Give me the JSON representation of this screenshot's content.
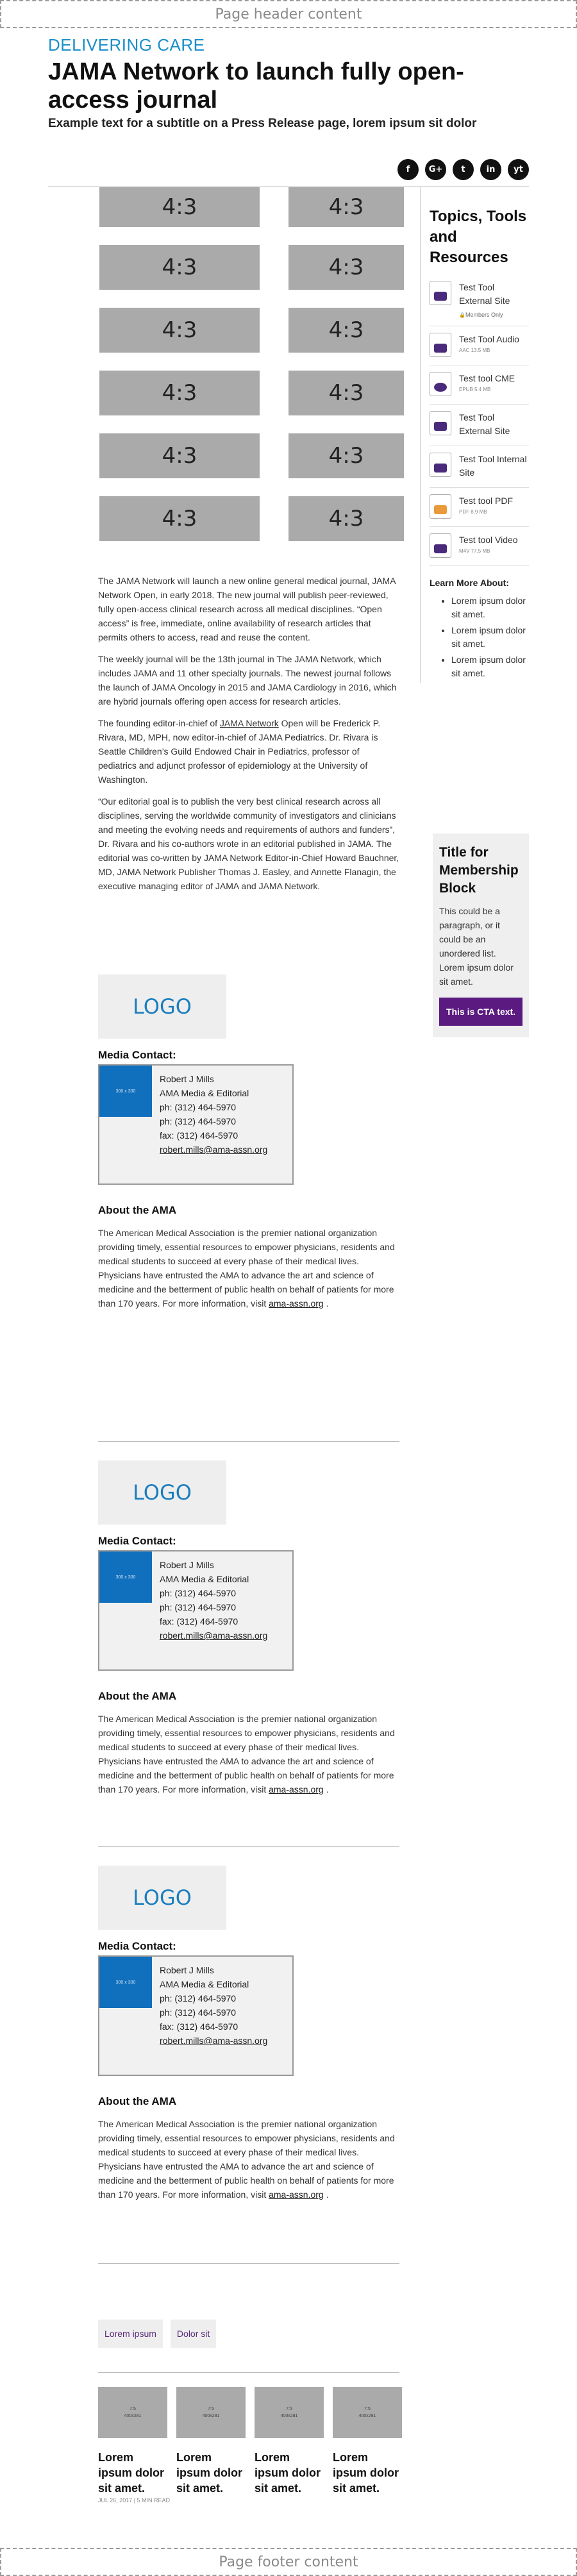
{
  "page_header": "Page header content",
  "page_footer": "Page footer content",
  "kicker": "DELIVERING CARE",
  "title": "JAMA Network to launch fully open-access journal",
  "subtitle": "Example text for a subtitle on a Press Release page, lorem ipsum sit dolor",
  "social": [
    "f",
    "G+",
    "t",
    "in",
    "yt"
  ],
  "ratio_label": "4:3",
  "body": {
    "p1": "The JAMA Network will launch a new online general medical journal, JAMA Network Open, in early 2018. The new journal will publish peer-reviewed, fully open-access clinical research across all medical disciplines. “Open access” is free, immediate, online availability of research articles that permits others to access, read and reuse the content.",
    "p2": "The weekly journal will be the 13th journal in The JAMA Network, which includes JAMA and 11 other specialty journals. The newest journal follows the launch of JAMA Oncology in 2015 and JAMA Cardiology in 2016, which are hybrid journals offering open access for research articles.",
    "p3a": "The founding editor-in-chief of ",
    "p3link": "JAMA Network",
    "p3b": " Open will be Frederick P. Rivara, MD, MPH, now editor-in-chief of JAMA Pediatrics. Dr. Rivara is Seattle Children’s Guild Endowed Chair in Pediatrics, professor of pediatrics and adjunct professor of epidemiology at the University of Washington.",
    "p4": "“Our editorial goal is to publish the very best clinical research across all disciplines, serving the worldwide community of investigators and clinicians and meeting the evolving needs and requirements of authors and funders”, Dr. Rivara and his co-authors wrote in an editorial published in JAMA. The editorial was co-written by JAMA Network Editor-in-Chief Howard Bauchner, MD, JAMA Network Publisher Thomas J. Easley, and Annette Flanagin, the executive managing editor of JAMA and JAMA Network."
  },
  "sidebar": {
    "heading": "Topics, Tools and Resources",
    "tools": [
      {
        "name": "Test Tool External Site",
        "meta": "",
        "badge": "Members Only",
        "icon": "external-site-icon"
      },
      {
        "name": "Test Tool Audio",
        "meta": "AAC        13.5 MB",
        "badge": "",
        "icon": "audio-icon"
      },
      {
        "name": "Test tool CME",
        "meta": "EPUB        5.4 MB",
        "badge": "",
        "icon": "cme-icon"
      },
      {
        "name": "Test Tool External Site",
        "meta": "",
        "badge": "",
        "icon": "external-site-icon"
      },
      {
        "name": "Test Tool Internal Site",
        "meta": "",
        "badge": "",
        "icon": "internal-site-icon"
      },
      {
        "name": "Test tool PDF",
        "meta": "PDF        8.9 MB",
        "badge": "",
        "icon": "pdf-icon"
      },
      {
        "name": "Test tool Video",
        "meta": "M4V        77.5 MB",
        "badge": "",
        "icon": "video-icon"
      }
    ],
    "learn_more": "Learn More About:",
    "learn_items": [
      "Lorem ipsum dolor sit amet.",
      "Lorem ipsum dolor sit amet.",
      "Lorem ipsum dolor sit amet."
    ]
  },
  "membership": {
    "title": "Title for Membership Block",
    "text": "This could be a paragraph, or it could be an unordered list. Lorem ipsum dolor sit amet.",
    "cta": "This is CTA text."
  },
  "contact": {
    "logo": "LOGO",
    "label": "Media Contact:",
    "photo": "300 x 300",
    "name": "Robert J Mills",
    "org": "AMA Media & Editorial",
    "ph1": "ph: (312) 464-5970",
    "ph2": "ph: (312) 464-5970",
    "fax": "fax: (312) 464-5970",
    "email": "robert.mills@ama-assn.org"
  },
  "about": {
    "title": "About the AMA",
    "text": "The American Medical Association is the premier national organization providing timely, essential resources to empower physicians, residents and medical students to succeed at every phase of their medical lives. Physicians have entrusted the AMA to advance the art and science of medicine and the betterment of public health on behalf of patients for more than 170 years. For more information, visit ",
    "link": "ama-assn.org",
    "end": " ."
  },
  "tags": [
    "Lorem ipsum",
    "Dolor sit"
  ],
  "related": {
    "thumb_ratio": "7:5",
    "thumb_size": "400x281",
    "items": [
      "Lorem ipsum dolor sit amet.",
      "Lorem ipsum dolor sit amet.",
      "Lorem ipsum dolor sit amet.",
      "Lorem ipsum dolor sit amet."
    ],
    "meta": "JUL 26, 2017  |  5 MIN READ"
  }
}
